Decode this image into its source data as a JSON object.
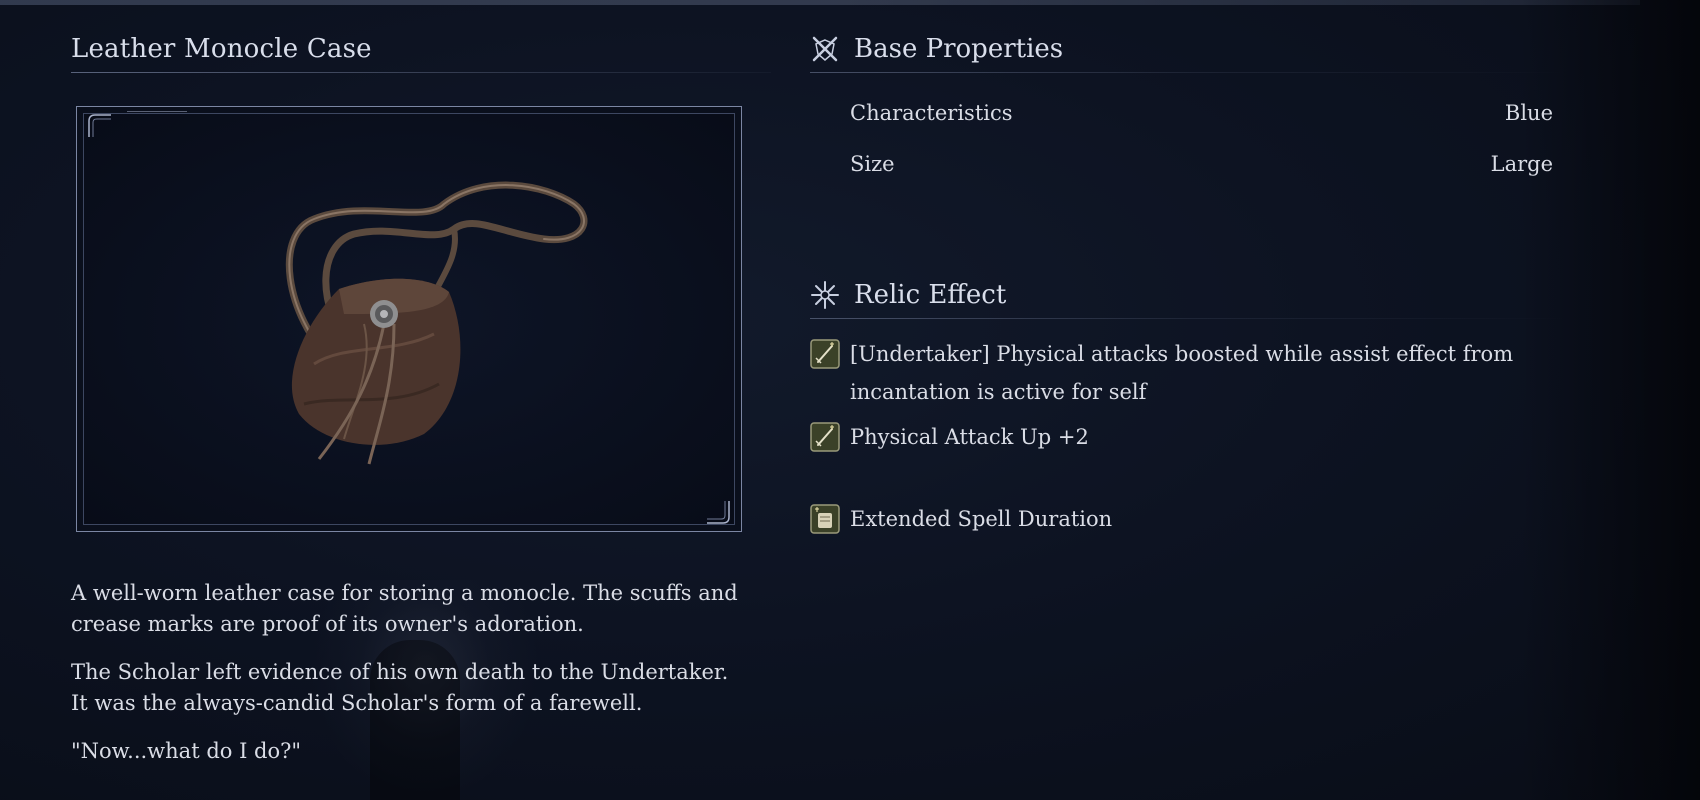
{
  "item": {
    "title": "Leather Monocle Case",
    "image_icon": "leather-pouch",
    "description": [
      "A well-worn leather case for storing a monocle. The scuffs and crease marks are proof of its owner's adoration.",
      "The Scholar left evidence of his own death to the Undertaker. It was the always-candid Scholar's form of a farewell.",
      "\"Now...what do I do?\""
    ]
  },
  "base_properties": {
    "heading": "Base Properties",
    "icon": "crossed-swords-icon",
    "rows": [
      {
        "label": "Characteristics",
        "value": "Blue"
      },
      {
        "label": "Size",
        "value": "Large"
      }
    ]
  },
  "relic_effect": {
    "heading": "Relic Effect",
    "icon": "starburst-icon",
    "effects": [
      {
        "text": "[Undertaker] Physical attacks boosted while assist effect from incantation is active for self",
        "icon": "sword-icon"
      },
      {
        "text": "Physical Attack Up +2",
        "icon": "sword-icon"
      },
      {
        "text": "Extended Spell Duration",
        "icon": "scroll-icon"
      }
    ]
  },
  "colors": {
    "background": "#0d1322",
    "text": "#dadde6",
    "frame": "#7b86a3"
  }
}
